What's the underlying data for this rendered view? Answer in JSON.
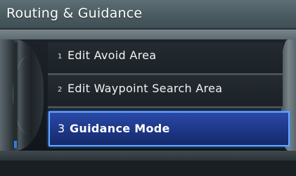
{
  "header": {
    "title": "Routing & Guidance"
  },
  "menu": {
    "items": [
      {
        "number": "1",
        "label": "Edit Avoid Area",
        "selected": false
      },
      {
        "number": "2",
        "label": "Edit Waypoint Search Area",
        "selected": false
      },
      {
        "number": "3",
        "label": "Guidance Mode",
        "selected": true
      }
    ]
  },
  "colors": {
    "selection_fill": "#203a8c",
    "selection_border": "#63a8ff",
    "title_bar": "#4a5a61"
  }
}
